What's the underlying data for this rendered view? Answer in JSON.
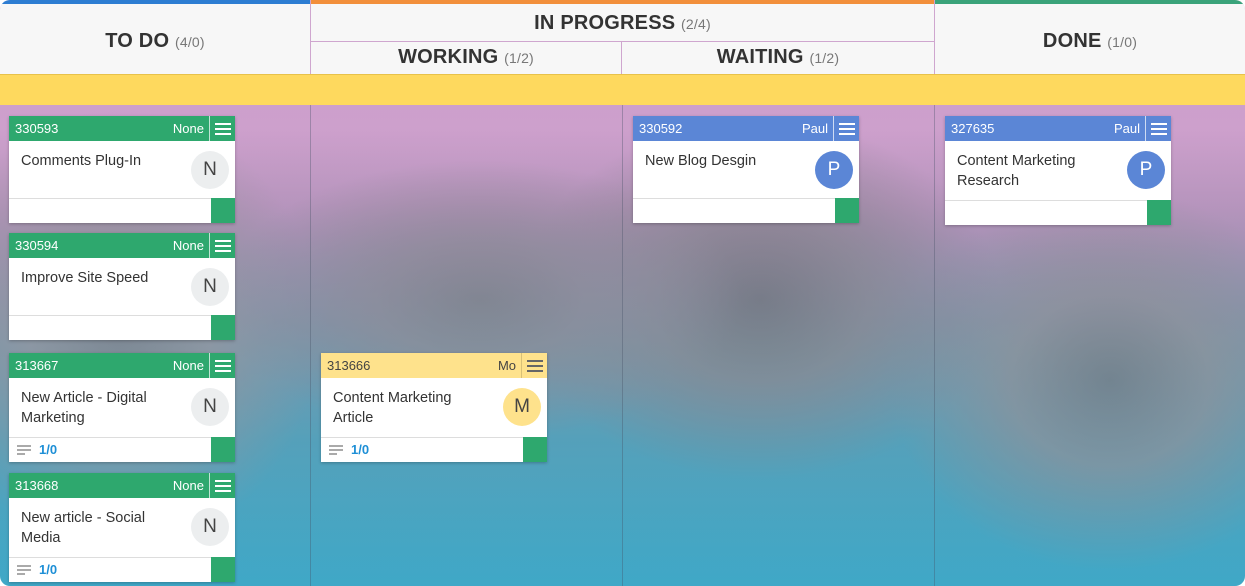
{
  "columns": {
    "todo": {
      "title": "TO DO",
      "count": "(4/0)",
      "color": "#2d7dd2"
    },
    "in_progress": {
      "title": "IN PROGRESS",
      "count": "(2/4)",
      "color": "#f28f3b"
    },
    "working": {
      "title": "WORKING",
      "count": "(1/2)"
    },
    "waiting": {
      "title": "WAITING",
      "count": "(1/2)"
    },
    "done": {
      "title": "DONE",
      "count": "(1/0)",
      "color": "#3aa37a"
    }
  },
  "cards": [
    {
      "id": "330593",
      "owner": "None",
      "title": "Comments Plug-In",
      "avatar": "N",
      "checklist": ""
    },
    {
      "id": "330594",
      "owner": "None",
      "title": "Improve Site Speed",
      "avatar": "N",
      "checklist": ""
    },
    {
      "id": "313667",
      "owner": "None",
      "title": "New Article - Digital Marketing",
      "avatar": "N",
      "checklist": "1/0"
    },
    {
      "id": "313668",
      "owner": "None",
      "title": "New article - Social Media",
      "avatar": "N",
      "checklist": "1/0"
    },
    {
      "id": "313666",
      "owner": "Mo",
      "title": "Content Marketing Article",
      "avatar": "M",
      "checklist": "1/0"
    },
    {
      "id": "330592",
      "owner": "Paul",
      "title": "New Blog Desgin",
      "avatar": "P",
      "checklist": ""
    },
    {
      "id": "327635",
      "owner": "Paul",
      "title": "Content Marketing Research",
      "avatar": "P",
      "checklist": ""
    }
  ],
  "colors": {
    "green_card": "#2ea86e",
    "blue_card": "#5b86d6",
    "yellow_card": "#fee28c",
    "swimlane_band": "#fed95e",
    "checklist_text": "#1e8fd6"
  },
  "icons": {
    "card_menu": "hamburger-menu-icon",
    "checklist": "checklist-icon"
  }
}
